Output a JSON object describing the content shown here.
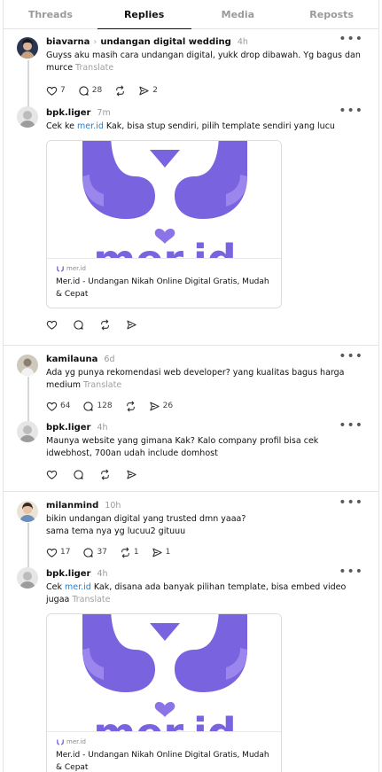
{
  "tabs": [
    {
      "label": "Threads"
    },
    {
      "label": "Replies"
    },
    {
      "label": "Media"
    },
    {
      "label": "Reposts"
    }
  ],
  "active_tab": "Replies",
  "more_glyph": "•••",
  "translate_label": "Translate",
  "accent_color": "#1d7fd1",
  "logo_color": "#7a63de",
  "threads": [
    {
      "post": {
        "username": "biavarna",
        "topic": "undangan digital wedding",
        "time": "4h",
        "text": "Guyss aku masih cara undangan digital, yukk drop dibawah. Yg bagus dan murce",
        "likes": "7",
        "replies": "28",
        "reposts": "",
        "shares": "2"
      },
      "reply": {
        "username": "bpk.liger",
        "time": "7m",
        "text_before": "Cek ke ",
        "link": "mer.id",
        "text_after": " Kak, bisa stup sendiri, pilih template sendiri yang lucu",
        "card": {
          "domain": "mer.id",
          "title": "Mer.id - Undangan Nikah Online Digital Gratis, Mudah & Cepat"
        }
      }
    },
    {
      "post": {
        "username": "kamilauna",
        "time": "6d",
        "text": "Ada yg punya rekomendasi web developer? yang kualitas bagus harga medium",
        "likes": "64",
        "replies": "128",
        "reposts": "",
        "shares": "26"
      },
      "reply": {
        "username": "bpk.liger",
        "time": "4h",
        "text": "Maunya website yang gimana Kak? Kalo company profil bisa cek idwebhost, 700an udah include domhost"
      }
    },
    {
      "post": {
        "username": "milanmind",
        "time": "10h",
        "text_line1": "bikin undangan digital yang trusted dmn yaaa?",
        "text_line2": "sama tema nya yg lucuu2 gituuu",
        "likes": "17",
        "replies": "37",
        "reposts": "1",
        "shares": "1"
      },
      "reply": {
        "username": "bpk.liger",
        "time": "4h",
        "text_before": "Cek ",
        "link": "mer.id",
        "text_after": " Kak, disana ada banyak pilihan template, bisa embed video jugaa",
        "card": {
          "domain": "mer.id",
          "title": "Mer.id - Undangan Nikah Online Digital Gratis, Mudah & Cepat"
        }
      }
    }
  ]
}
